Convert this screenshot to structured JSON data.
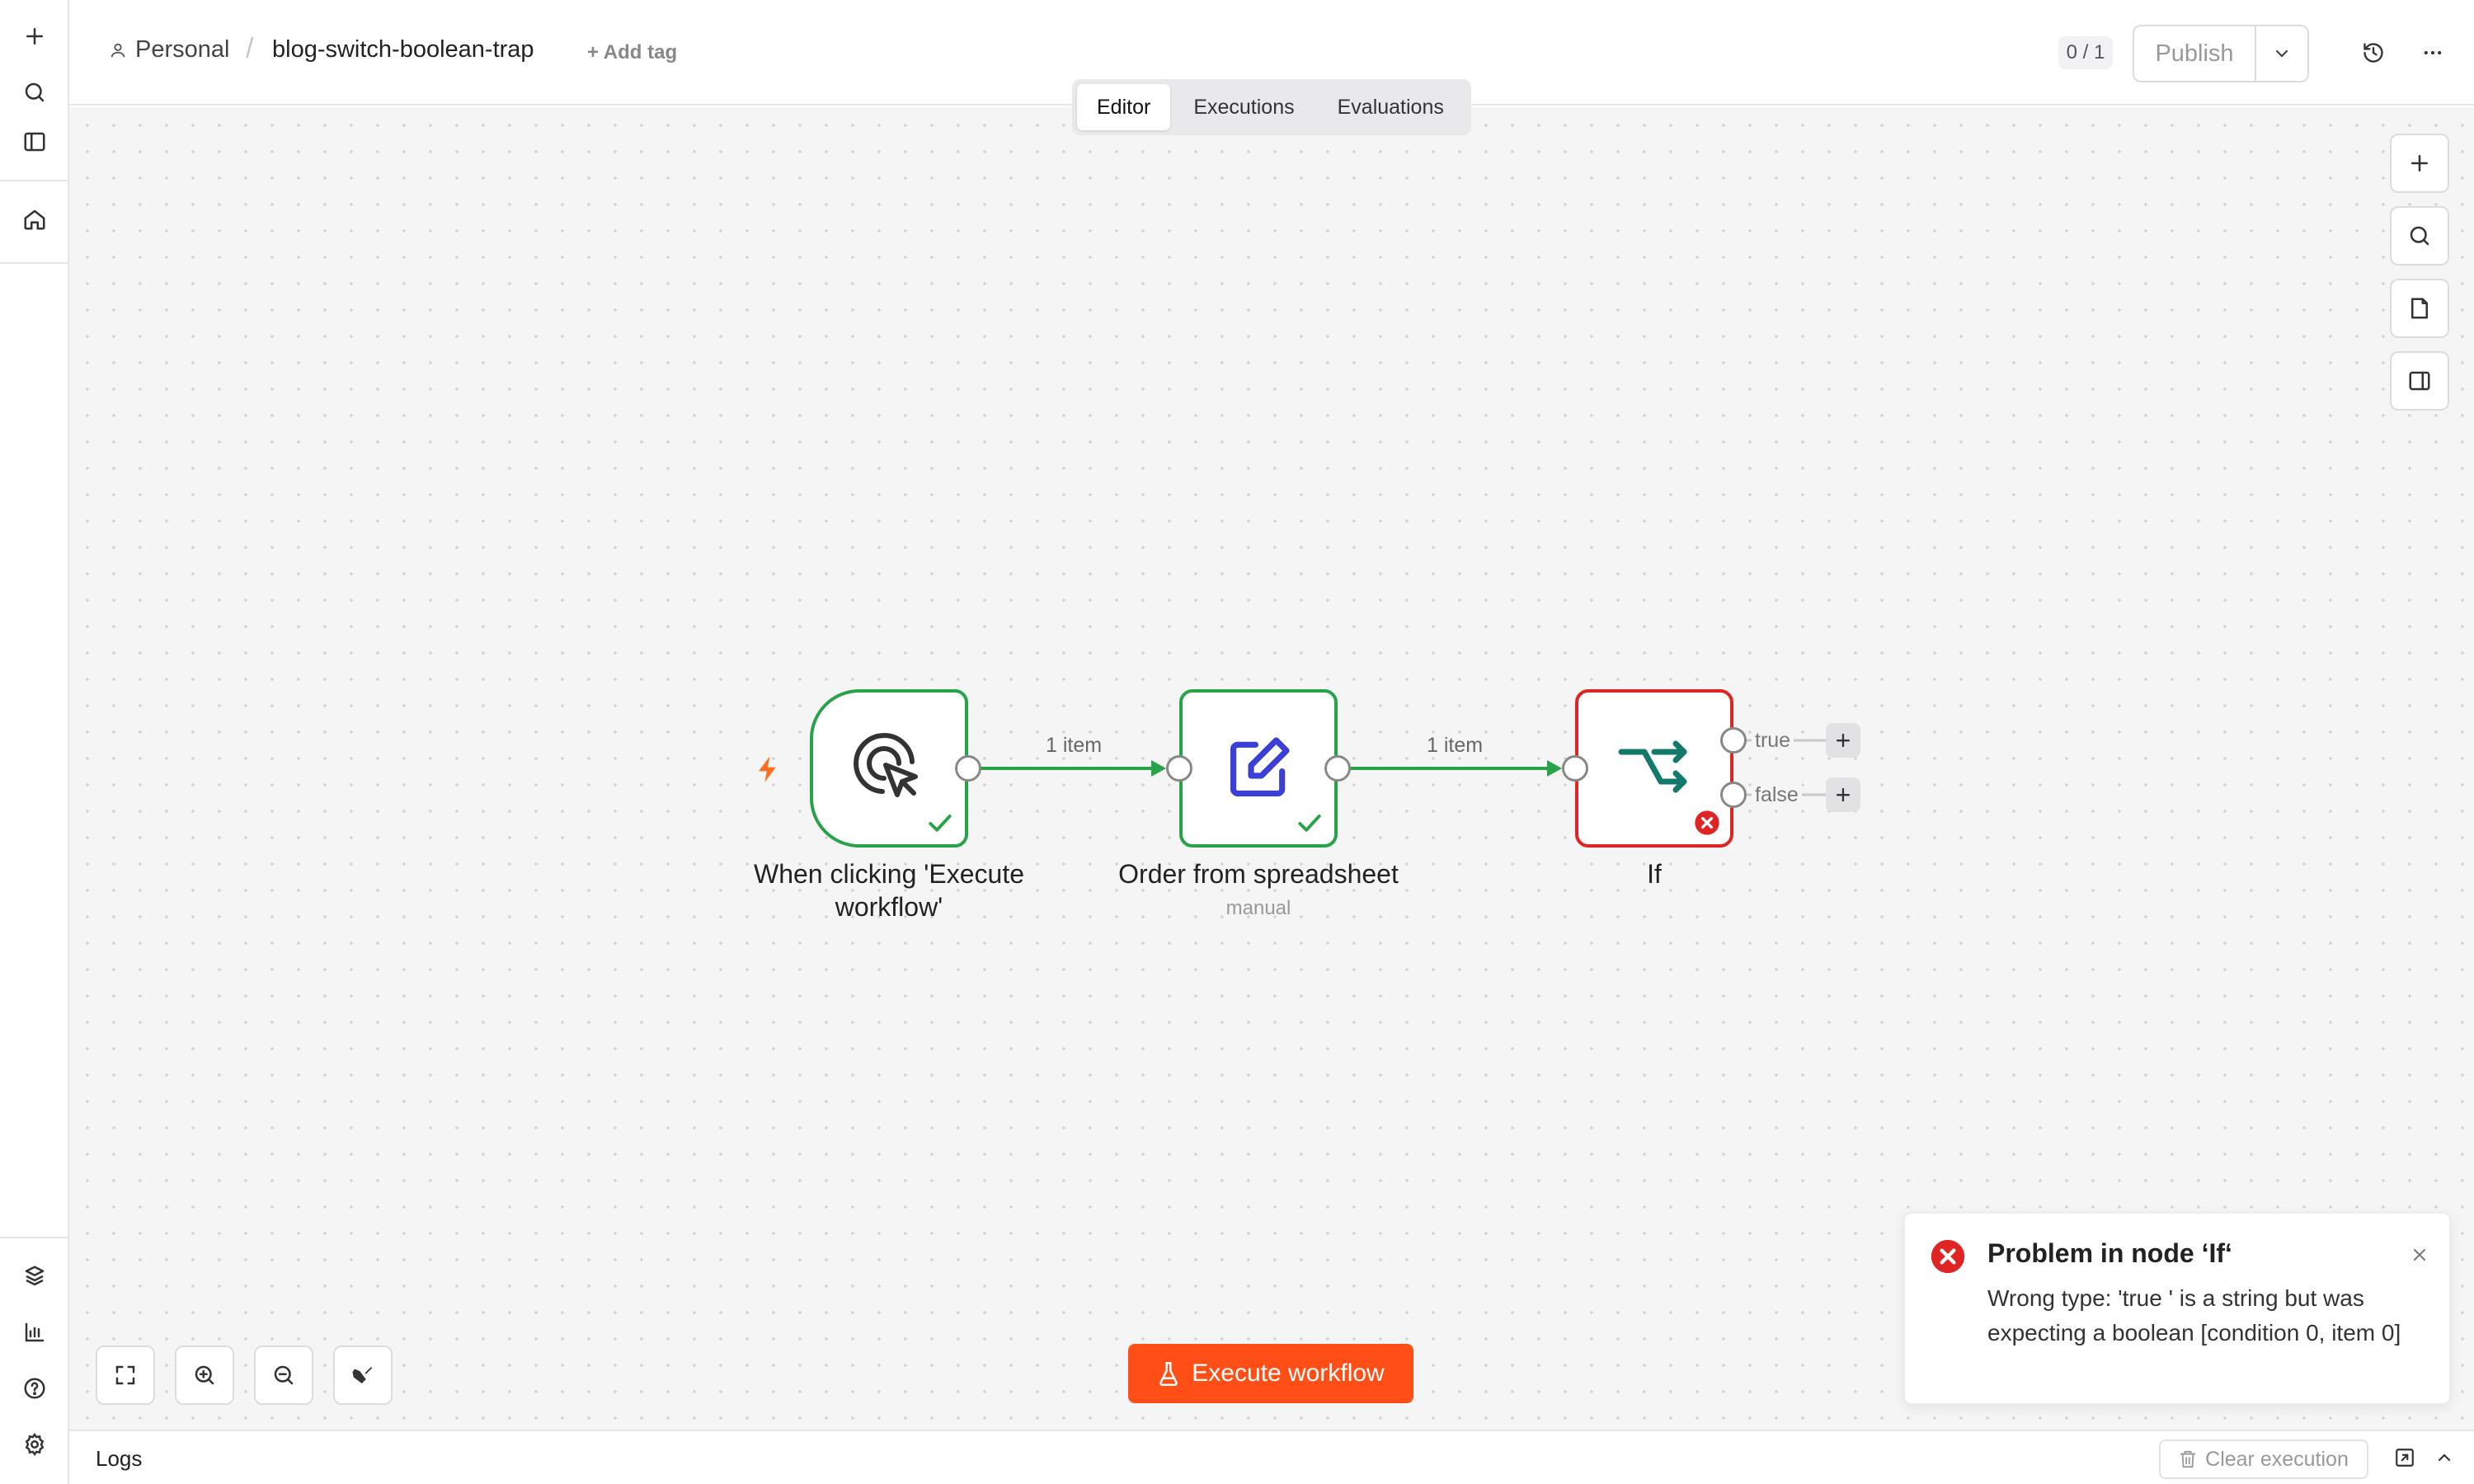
{
  "header": {
    "owner": "Personal",
    "workflow_name": "blog-switch-boolean-trap",
    "add_tag": "+ Add tag",
    "counter": "0 / 1",
    "publish_label": "Publish"
  },
  "tabs": [
    {
      "label": "Editor",
      "active": true
    },
    {
      "label": "Executions",
      "active": false
    },
    {
      "label": "Evaluations",
      "active": false
    }
  ],
  "nodes": {
    "trigger": {
      "label": "When clicking 'Execute workflow'",
      "status": "success",
      "icon": "cursor-click-icon"
    },
    "set": {
      "label": "Order from spreadsheet",
      "subtitle": "manual",
      "status": "success",
      "icon": "pen-edit-icon"
    },
    "if": {
      "label": "If",
      "status": "error",
      "icon": "branch-icon",
      "outputs": [
        "true",
        "false"
      ]
    }
  },
  "edges": [
    {
      "from": "trigger",
      "to": "set",
      "label": "1 item"
    },
    {
      "from": "set",
      "to": "if",
      "label": "1 item"
    }
  ],
  "execute_button": "Execute workflow",
  "toast": {
    "title": "Problem in node ‘If‘",
    "message": "Wrong type: 'true ' is a string but was expecting a boolean [condition 0, item 0]"
  },
  "logs": {
    "title": "Logs",
    "clear_label": "Clear execution"
  },
  "colors": {
    "success": "#29a34a",
    "error": "#e02424",
    "accent": "#ff4f17",
    "set_icon": "#3b3fd8",
    "if_icon": "#137a6b",
    "trigger_bolt": "#ff6d1f"
  }
}
